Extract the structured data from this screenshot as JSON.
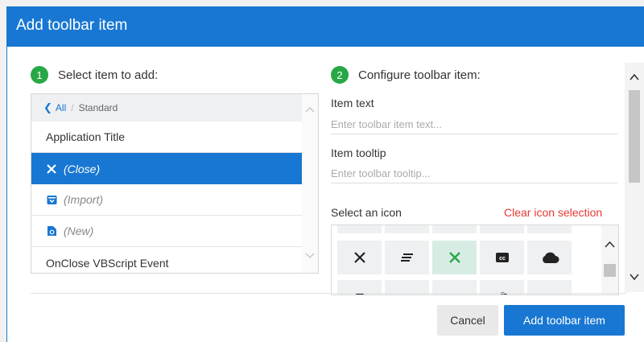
{
  "dialog": {
    "title": "Add toolbar item",
    "accent_color": "#1877d2",
    "step1": {
      "num": "1",
      "label": "Select item to add:"
    },
    "step2": {
      "num": "2",
      "label": "Configure toolbar item:"
    },
    "step_badge_color": "#28a745"
  },
  "item_list": {
    "breadcrumb": {
      "back": "All",
      "separator": "/",
      "current": "Standard"
    },
    "items": [
      {
        "label": "Application Title",
        "italic": false,
        "icon": null,
        "selected": false
      },
      {
        "label": "(Close)",
        "italic": true,
        "icon": "close-icon",
        "selected": true
      },
      {
        "label": "(Import)",
        "italic": true,
        "icon": "import-icon",
        "selected": false
      },
      {
        "label": "(New)",
        "italic": true,
        "icon": "new-document-icon",
        "selected": false
      },
      {
        "label": "OnClose VBScript Event",
        "italic": false,
        "icon": null,
        "selected": false
      }
    ]
  },
  "config": {
    "item_text": {
      "label": "Item text",
      "value": "",
      "placeholder": "Enter toolbar item text..."
    },
    "item_tooltip": {
      "label": "Item tooltip",
      "value": "",
      "placeholder": "Enter toolbar tooltip..."
    },
    "icon_select": {
      "label": "Select an icon",
      "clear_label": "Clear icon selection"
    },
    "icon_rows": [
      [
        "partial-icon",
        "partial-icon",
        "partial-icon",
        "partial-icon",
        "partial-icon"
      ],
      [
        "close-icon",
        "align-lines-icon",
        "close-green-icon",
        "closed-caption-icon",
        "cloud-icon"
      ],
      [
        "partial-icon",
        "partial-icon",
        "partial-icon",
        "partial-icon",
        "partial-icon"
      ]
    ],
    "selected_icon": "close-green-icon"
  },
  "buttons": {
    "cancel": "Cancel",
    "add": "Add toolbar item"
  }
}
